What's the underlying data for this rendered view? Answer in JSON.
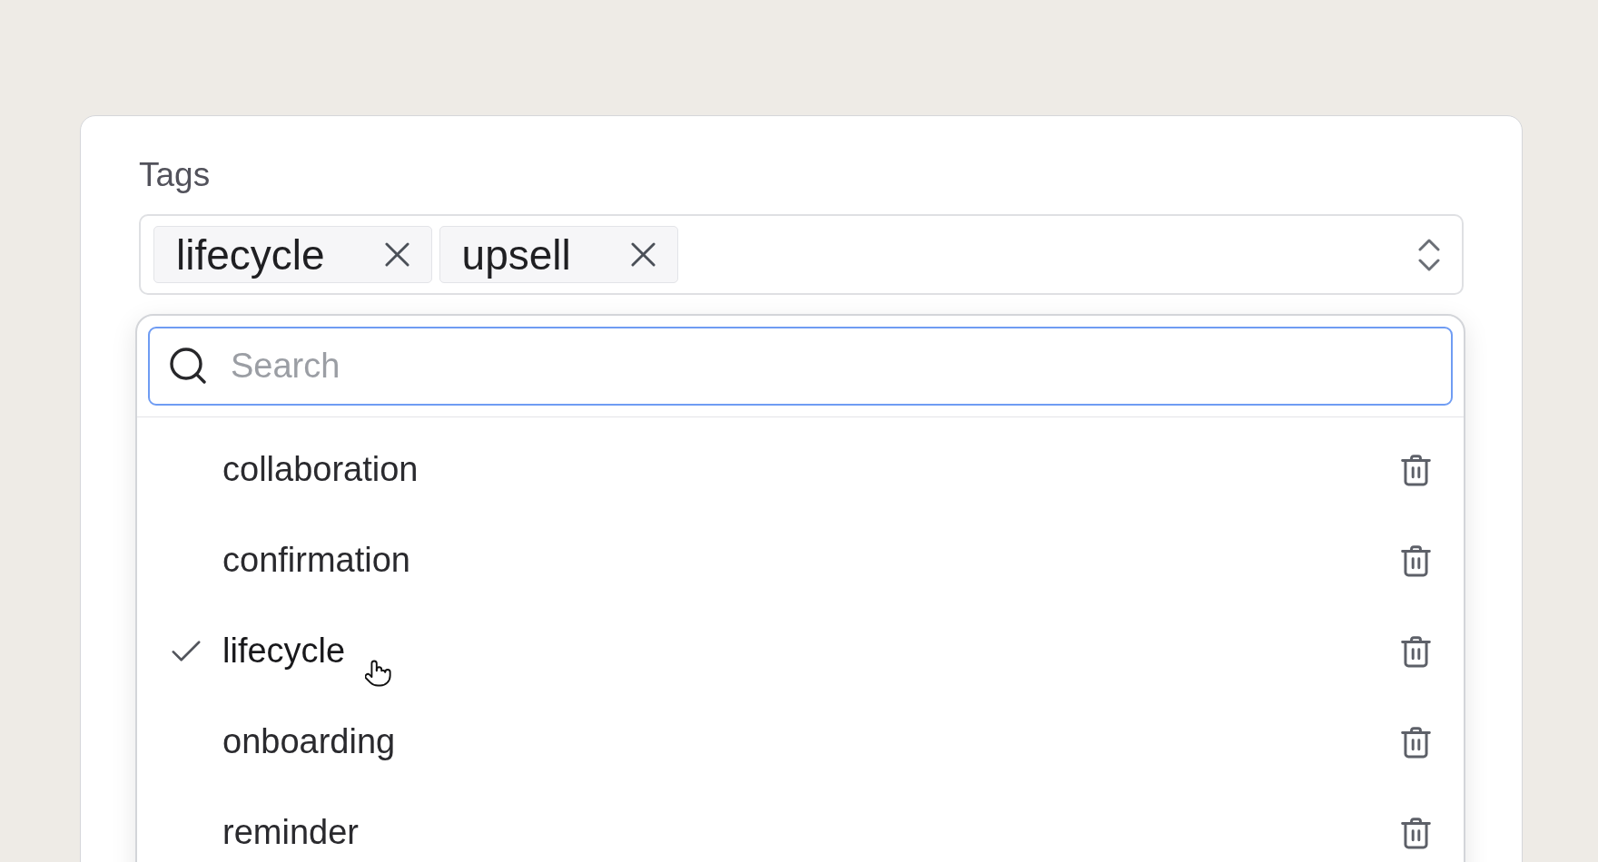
{
  "field": {
    "label": "Tags",
    "selected_tags": [
      "lifecycle",
      "upsell"
    ]
  },
  "dropdown": {
    "search": {
      "placeholder": "Search"
    },
    "options": [
      {
        "label": "collaboration",
        "selected": false
      },
      {
        "label": "confirmation",
        "selected": false
      },
      {
        "label": "lifecycle",
        "selected": true
      },
      {
        "label": "onboarding",
        "selected": false
      },
      {
        "label": "reminder",
        "selected": false
      }
    ]
  }
}
